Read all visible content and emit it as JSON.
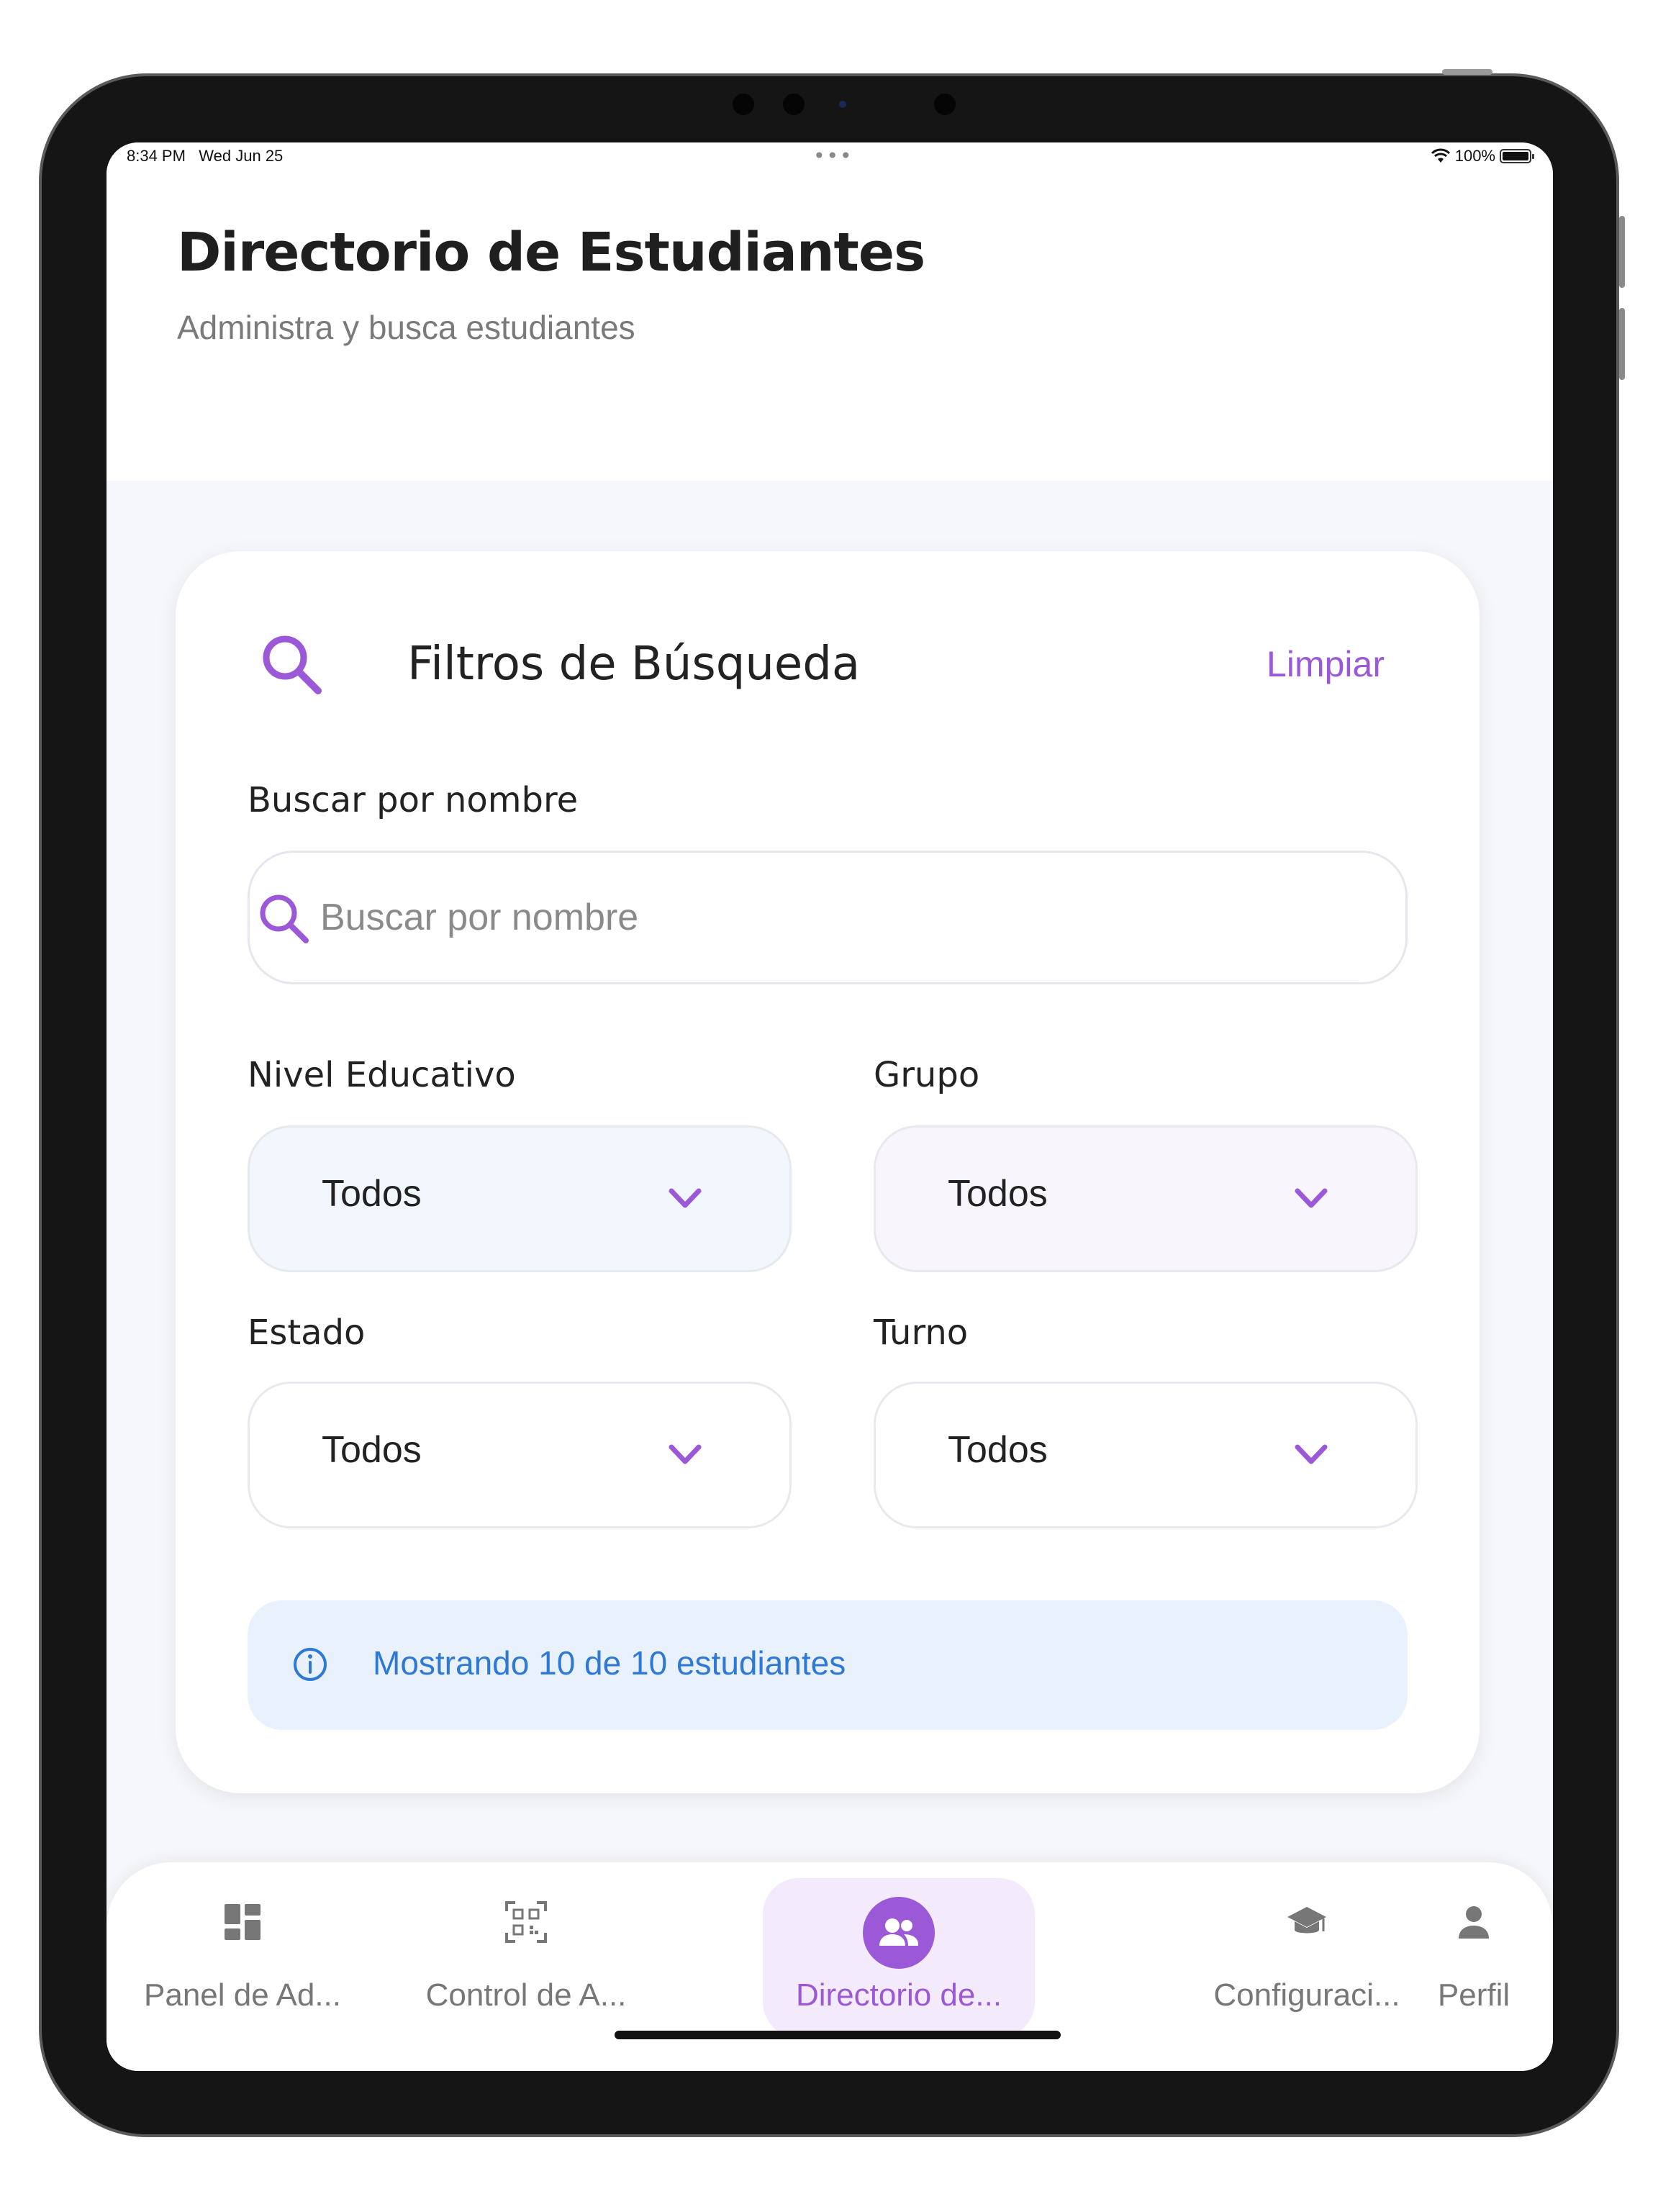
{
  "status_bar": {
    "time": "8:34 PM",
    "date": "Wed Jun 25",
    "battery": "100%",
    "icons": [
      "wifi-icon",
      "battery-icon"
    ]
  },
  "header": {
    "title": "Directorio de Estudiantes",
    "subtitle": "Administra y busca estudiantes"
  },
  "filters": {
    "title": "Filtros de Búsqueda",
    "clear_label": "Limpiar",
    "search_label": "Buscar por nombre",
    "search_placeholder": "Buscar por nombre",
    "search_value": "",
    "nivel": {
      "label": "Nivel Educativo",
      "value": "Todos"
    },
    "grupo": {
      "label": "Grupo",
      "value": "Todos"
    },
    "estado": {
      "label": "Estado",
      "value": "Todos"
    },
    "turno": {
      "label": "Turno",
      "value": "Todos"
    },
    "info_text": "Mostrando 10 de 10 estudiantes"
  },
  "tabs": [
    {
      "label": "Panel de Ad...",
      "icon": "dashboard-icon",
      "active": false
    },
    {
      "label": "Control de A...",
      "icon": "qr-code-icon",
      "active": false
    },
    {
      "label": "Directorio de...",
      "icon": "people-icon",
      "active": true
    },
    {
      "label": "Configuraci...",
      "icon": "graduation-cap-icon",
      "active": false
    },
    {
      "label": "Perfil",
      "icon": "person-icon",
      "active": false
    }
  ],
  "colors": {
    "accent": "#9b59d8",
    "info_text": "#2f79d6",
    "info_bg": "#e9f1fd",
    "nivel_bg": "#f2f6fd",
    "grupo_bg": "#f8f5fd"
  }
}
